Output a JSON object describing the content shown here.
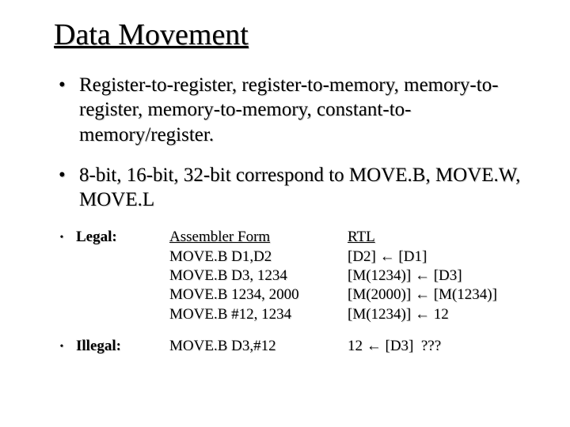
{
  "title": "Data Movement",
  "bullet1": "Register-to-register, register-to-memory, memory-to-register, memory-to-memory, constant-to-memory/register.",
  "bullet2": "8-bit, 16-bit, 32-bit correspond to MOVE.B, MOVE.W, MOVE.L",
  "legal": {
    "label": "Legal:",
    "asm_header": "Assembler Form",
    "rtl_header": "RTL",
    "rows": [
      {
        "asm": "MOVE.B D1,D2",
        "rtl": "[D2] ← [D1]"
      },
      {
        "asm": "MOVE.B D3, 1234",
        "rtl": "[M(1234)] ← [D3]"
      },
      {
        "asm": "MOVE.B 1234, 2000",
        "rtl": "[M(2000)] ← [M(1234)]"
      },
      {
        "asm": "MOVE.B #12, 1234",
        "rtl": "[M(1234)] ← 12"
      }
    ]
  },
  "illegal": {
    "label": "Illegal:",
    "asm": "MOVE.B D3,#12",
    "rtl": "12 ← [D3]  ???"
  }
}
